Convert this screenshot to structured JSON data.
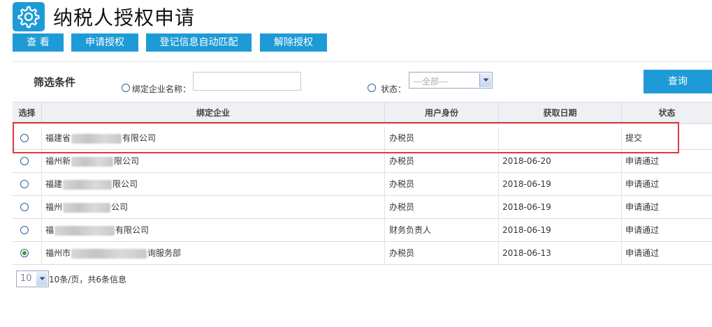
{
  "header": {
    "title": "纳税人授权申请",
    "icon": "gear-icon",
    "icon_color": "#1e9bd7"
  },
  "toolbar": {
    "view_label": "查 看",
    "apply_label": "申请授权",
    "auto_match_label": "登记信息自动匹配",
    "revoke_label": "解除授权"
  },
  "filter": {
    "title": "筛选条件",
    "company_label": "绑定企业名称：",
    "company_value": "",
    "status_label": "状态：",
    "status_value": "---全部---",
    "query_label": "查询"
  },
  "table": {
    "columns": [
      "选择",
      "绑定企业",
      "用户身份",
      "获取日期",
      "状态"
    ],
    "rows": [
      {
        "selected": false,
        "company_prefix": "福建省",
        "company_suffix": "有限公司",
        "role": "办税员",
        "date": "",
        "status": "提交"
      },
      {
        "selected": false,
        "company_prefix": "福州新",
        "company_suffix": "限公司",
        "role": "办税员",
        "date": "2018-06-20",
        "status": "申请通过"
      },
      {
        "selected": false,
        "company_prefix": "福建",
        "company_suffix": "限公司",
        "role": "办税员",
        "date": "2018-06-19",
        "status": "申请通过"
      },
      {
        "selected": false,
        "company_prefix": "福州",
        "company_suffix": "公司",
        "role": "办税员",
        "date": "2018-06-19",
        "status": "申请通过"
      },
      {
        "selected": false,
        "company_prefix": "福",
        "company_suffix": "有限公司",
        "role": "财务负责人",
        "date": "2018-06-19",
        "status": "申请通过"
      },
      {
        "selected": true,
        "company_prefix": "福州市",
        "company_suffix": "询服务部",
        "role": "办税员",
        "date": "2018-06-13",
        "status": "申请通过"
      }
    ]
  },
  "pager": {
    "page_size": "10",
    "summary": "10条/页，共6条信息"
  },
  "colors": {
    "accent": "#1e9bd7",
    "highlight": "#e0393c"
  }
}
